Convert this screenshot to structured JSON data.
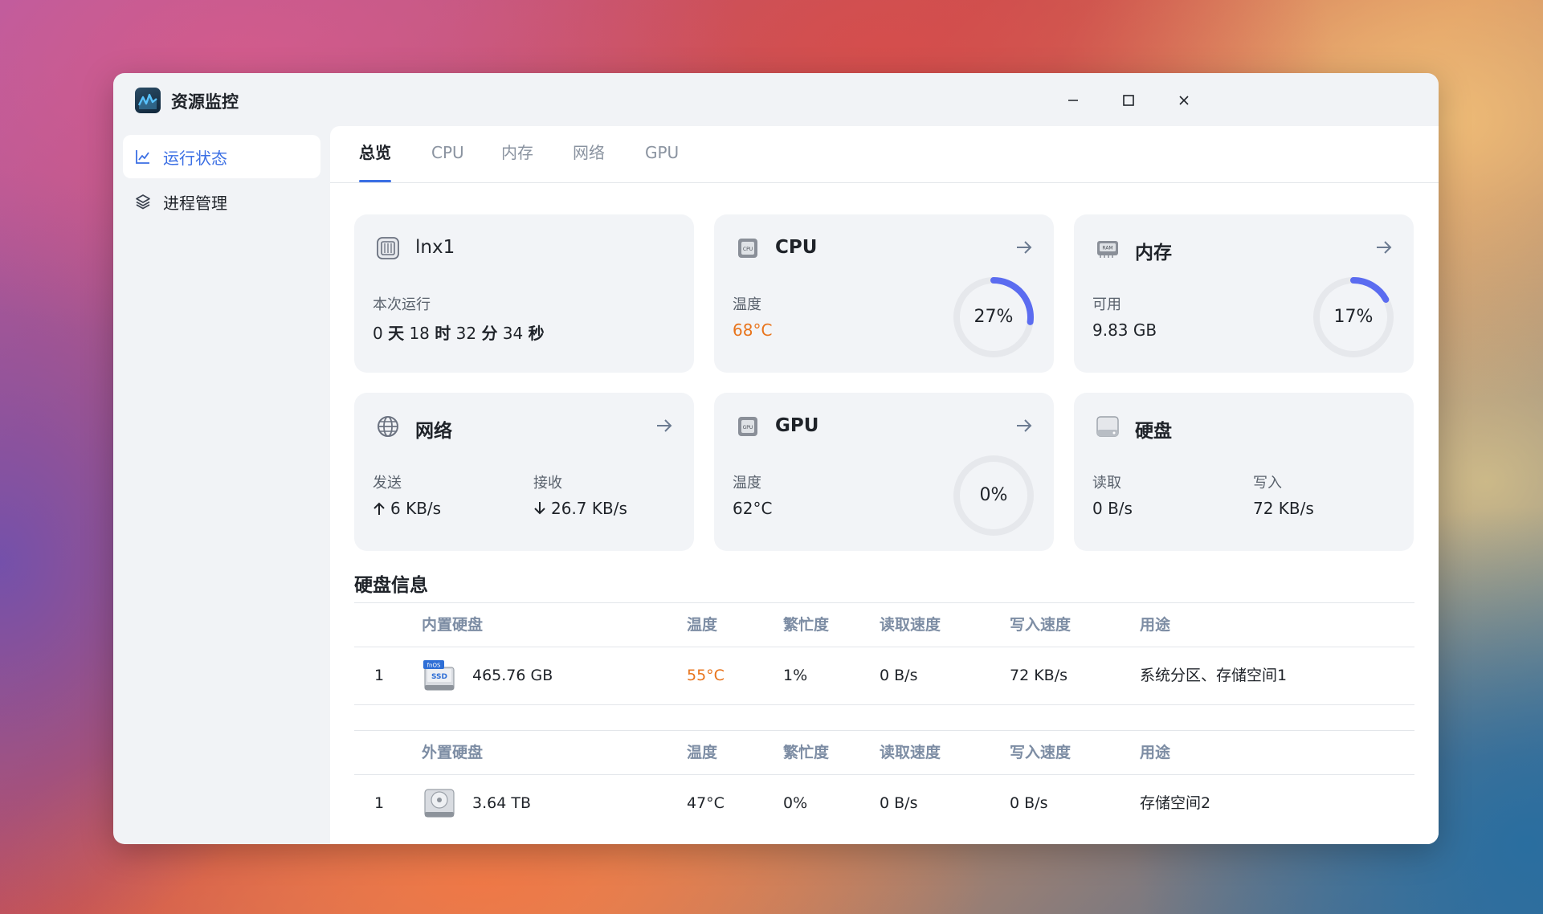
{
  "window": {
    "title": "资源监控"
  },
  "sidebar": {
    "items": [
      {
        "label": "运行状态",
        "icon": "line-chart-icon",
        "active": true
      },
      {
        "label": "进程管理",
        "icon": "layers-icon",
        "active": false
      }
    ]
  },
  "tabs": [
    {
      "label": "总览",
      "active": true
    },
    {
      "label": "CPU"
    },
    {
      "label": "内存"
    },
    {
      "label": "网络"
    },
    {
      "label": "GPU"
    }
  ],
  "cards": {
    "host": {
      "title": "lnx1",
      "uptime_label": "本次运行",
      "uptime": {
        "d": "0",
        "d_unit": "天",
        "h": "18",
        "h_unit": "时",
        "m": "32",
        "m_unit": "分",
        "s": "34",
        "s_unit": "秒"
      }
    },
    "cpu": {
      "title": "CPU",
      "temp_label": "温度",
      "temp": "68°C",
      "temp_color": "#e8741c",
      "usage": "27%",
      "usage_pct": 27
    },
    "memory": {
      "title": "内存",
      "avail_label": "可用",
      "avail": "9.83 GB",
      "usage": "17%",
      "usage_pct": 17
    },
    "network": {
      "title": "网络",
      "send_label": "发送",
      "send": "6 KB/s",
      "recv_label": "接收",
      "recv": "26.7 KB/s"
    },
    "gpu": {
      "title": "GPU",
      "temp_label": "温度",
      "temp": "62°C",
      "usage": "0%",
      "usage_pct": 0
    },
    "disk": {
      "title": "硬盘",
      "read_label": "读取",
      "read": "0 B/s",
      "write_label": "写入",
      "write": "72 KB/s"
    }
  },
  "disk_info": {
    "title": "硬盘信息",
    "internal": {
      "headers": [
        "内置硬盘",
        "温度",
        "繁忙度",
        "读取速度",
        "写入速度",
        "用途"
      ],
      "rows": [
        {
          "index": "1",
          "badge": "fnOS",
          "badge2": "SSD",
          "size": "465.76 GB",
          "temp": "55°C",
          "temp_color": "#e8741c",
          "busy": "1%",
          "read": "0 B/s",
          "write": "72 KB/s",
          "usage": "系统分区、存储空间1"
        }
      ]
    },
    "external": {
      "headers": [
        "外置硬盘",
        "温度",
        "繁忙度",
        "读取速度",
        "写入速度",
        "用途"
      ],
      "rows": [
        {
          "index": "1",
          "size": "3.64 TB",
          "temp": "47°C",
          "busy": "0%",
          "read": "0 B/s",
          "write": "0 B/s",
          "usage": "存储空间2"
        }
      ]
    }
  },
  "colors": {
    "accent": "#3b6fe4",
    "gauge": "#5b6cf0",
    "warn": "#e8741c"
  }
}
